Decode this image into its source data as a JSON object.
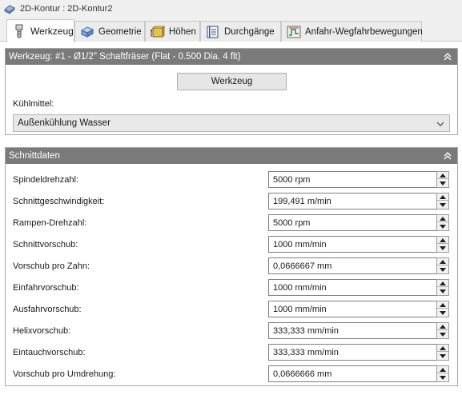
{
  "window": {
    "title": "2D-Kontur : 2D-Kontur2"
  },
  "tabs": [
    {
      "label": "Werkzeug",
      "active": true
    },
    {
      "label": "Geometrie",
      "active": false
    },
    {
      "label": "Höhen",
      "active": false
    },
    {
      "label": "Durchgänge",
      "active": false
    },
    {
      "label": "Anfahr-Wegfahrbewegungen",
      "active": false
    }
  ],
  "tool_group": {
    "header": "Werkzeug: #1 - Ø1/2\" Schaftfräser (Flat - 0.500 Dia. 4 flt)",
    "button_label": "Werkzeug",
    "coolant_label": "Kühlmittel:",
    "coolant_value": "Außenkühlung Wasser"
  },
  "cut_group": {
    "header": "Schnittdaten",
    "rows": [
      {
        "label": "Spindeldrehzahl:",
        "value": "5000 rpm"
      },
      {
        "label": "Schnittgeschwindigkeit:",
        "value": "199,491 m/min"
      },
      {
        "label": "Rampen-Drehzahl:",
        "value": "5000 rpm"
      },
      {
        "label": "Schnittvorschub:",
        "value": "1000 mm/min"
      },
      {
        "label": "Vorschub pro Zahn:",
        "value": "0,0666667 mm"
      },
      {
        "label": "Einfahrvorschub:",
        "value": "1000 mm/min"
      },
      {
        "label": "Ausfahrvorschub:",
        "value": "1000 mm/min"
      },
      {
        "label": "Helixvorschub:",
        "value": "333,333 mm/min"
      },
      {
        "label": "Eintauchvorschub:",
        "value": "333,333 mm/min"
      },
      {
        "label": "Vorschub pro Umdrehung:",
        "value": "0,0666666 mm"
      }
    ]
  },
  "colors": {
    "group_header": "#7a7a7a",
    "tab_active": "#ffffff",
    "window_bg": "#f0f0f0"
  },
  "icons": {
    "title": "contour-icon",
    "tabs": [
      "tool-icon",
      "geometry-icon",
      "heights-icon",
      "passes-icon",
      "linking-icon"
    ]
  }
}
